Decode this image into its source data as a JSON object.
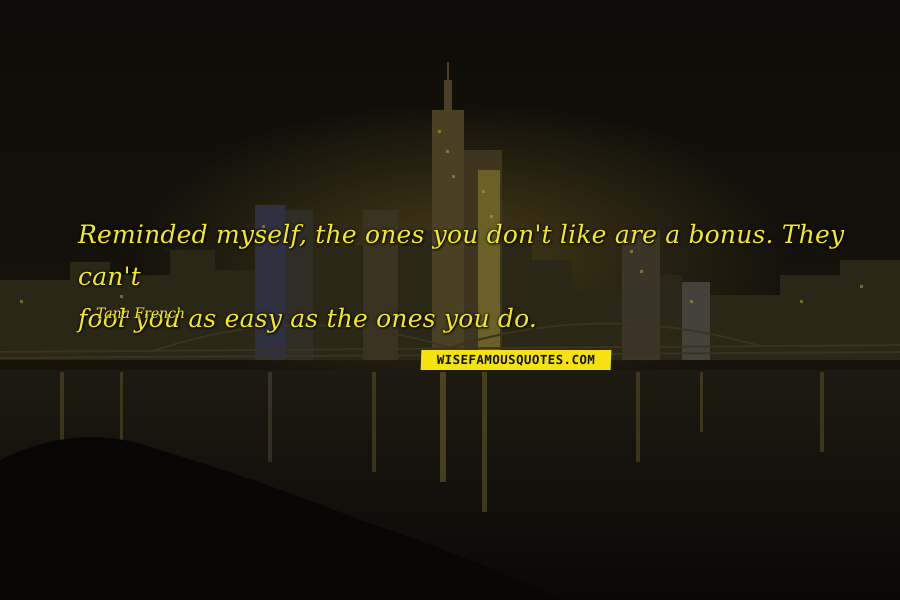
{
  "quote": {
    "line1": "Reminded myself, the ones you don't like are a bonus. They can't",
    "line2": "fool you as easy as the ones you do."
  },
  "author": "Tana French",
  "watermark": "WISEFAMOUSQUOTES.COM",
  "colors": {
    "quote_text": "#f3e81a",
    "watermark_bg": "#f5e20e"
  }
}
